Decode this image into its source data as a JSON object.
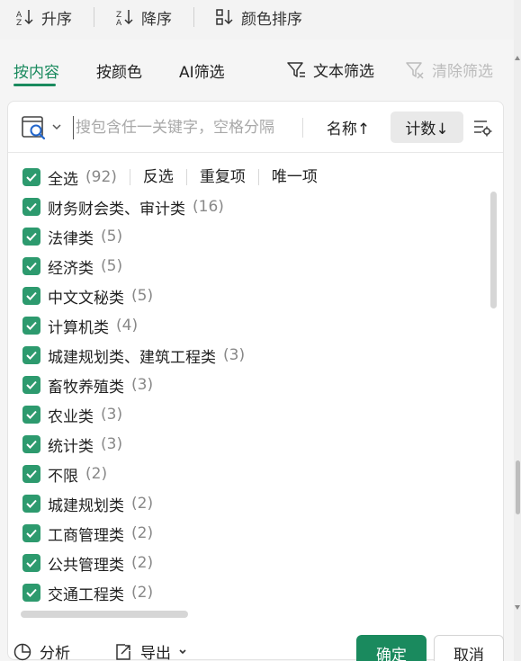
{
  "sort_toolbar": {
    "ascending": "升序",
    "descending": "降序",
    "color_sort": "颜色排序"
  },
  "tabs": {
    "by_content": "按内容",
    "by_color": "按颜色",
    "ai_filter": "AI筛选",
    "text_filter": "文本筛选",
    "clear_filter": "清除筛选"
  },
  "search": {
    "placeholder": "搜包含任一关键字，空格分隔",
    "value": ""
  },
  "sort_buttons": {
    "by_name": "名称↑",
    "by_count": "计数↓"
  },
  "select_all": {
    "label": "全选",
    "count": "(92)",
    "invert": "反选",
    "duplicates": "重复项",
    "unique": "唯一项"
  },
  "items": [
    {
      "label": "财务财会类、审计类",
      "count": "(16)",
      "checked": true
    },
    {
      "label": "法律类",
      "count": "(5)",
      "checked": true
    },
    {
      "label": "经济类",
      "count": "(5)",
      "checked": true
    },
    {
      "label": "中文文秘类",
      "count": "(5)",
      "checked": true
    },
    {
      "label": "计算机类",
      "count": "(4)",
      "checked": true
    },
    {
      "label": "城建规划类、建筑工程类",
      "count": "(3)",
      "checked": true
    },
    {
      "label": "畜牧养殖类",
      "count": "(3)",
      "checked": true
    },
    {
      "label": "农业类",
      "count": "(3)",
      "checked": true
    },
    {
      "label": "统计类",
      "count": "(3)",
      "checked": true
    },
    {
      "label": "不限",
      "count": "(2)",
      "checked": true
    },
    {
      "label": "城建规划类",
      "count": "(2)",
      "checked": true
    },
    {
      "label": "工商管理类",
      "count": "(2)",
      "checked": true
    },
    {
      "label": "公共管理类",
      "count": "(2)",
      "checked": true
    },
    {
      "label": "交通工程类",
      "count": "(2)",
      "checked": true
    }
  ],
  "footer": {
    "analyze": "分析",
    "export": "导出",
    "confirm": "确定",
    "cancel": "取消"
  },
  "colors": {
    "accent": "#1a8a5e",
    "checkbox": "#2d9a6e"
  }
}
